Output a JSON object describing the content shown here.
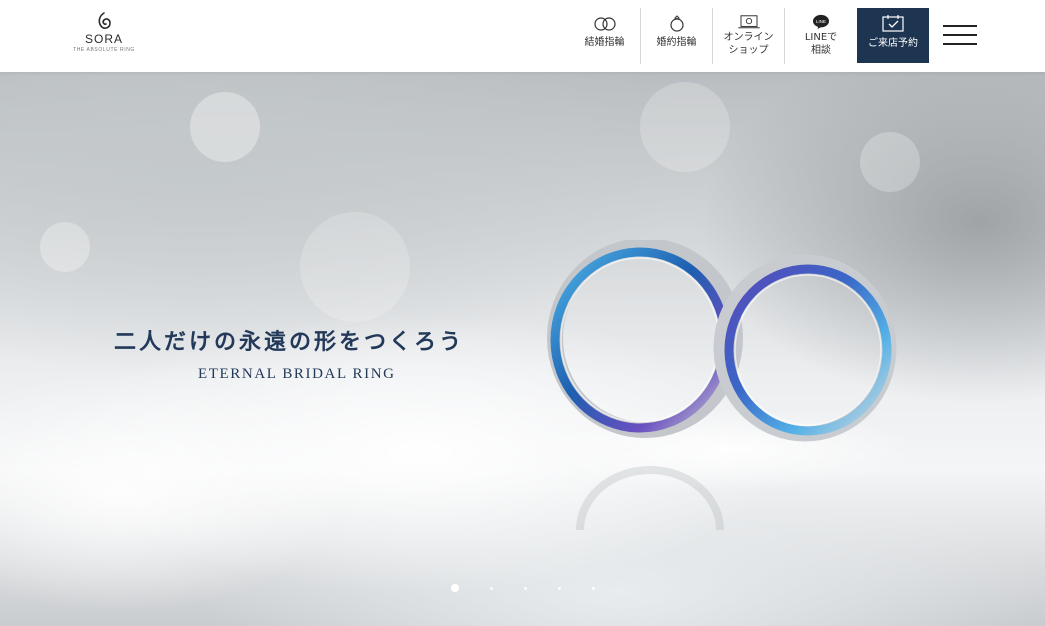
{
  "brand": {
    "name": "SORA",
    "tagline": "THE ABSOLUTE RING"
  },
  "nav": {
    "items": [
      {
        "label": "結婚指輪",
        "icon": "wedding-rings-icon"
      },
      {
        "label": "婚約指輪",
        "icon": "engagement-ring-icon"
      },
      {
        "label": "オンライン\nショップ",
        "icon": "laptop-shop-icon"
      },
      {
        "label": "LINEで\n相談",
        "icon": "line-chat-icon"
      }
    ],
    "reserve_label": "ご来店予約",
    "reserve_icon": "calendar-check-icon",
    "menu_icon": "hamburger-menu-icon"
  },
  "hero": {
    "headline": "二人だけの永遠の形をつくろう",
    "subline": "ETERNAL BRIDAL RING",
    "slide_count": 5,
    "active_slide": 1
  },
  "colors": {
    "navy": "#1e3551",
    "headline": "#23395a"
  }
}
